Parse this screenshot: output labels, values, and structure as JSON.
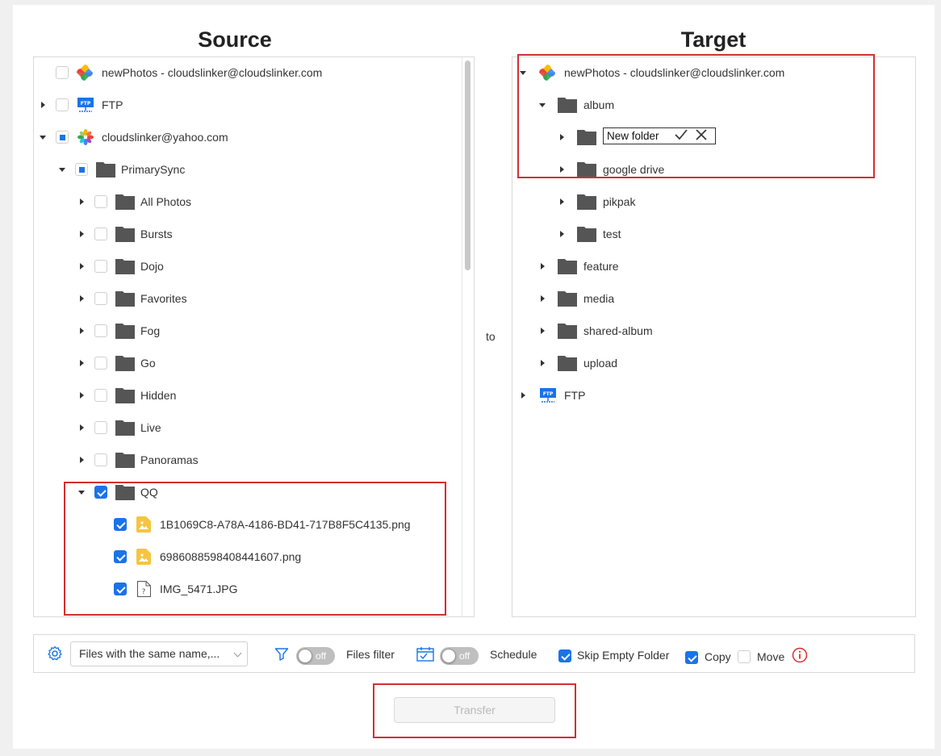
{
  "source": {
    "heading": "Source",
    "items": [
      {
        "label": "newPhotos - cloudslinker@cloudslinker.com"
      },
      {
        "label": "FTP"
      },
      {
        "label": "cloudslinker@yahoo.com"
      },
      {
        "label": "PrimarySync"
      },
      {
        "label": "All Photos"
      },
      {
        "label": "Bursts"
      },
      {
        "label": "Dojo"
      },
      {
        "label": "Favorites"
      },
      {
        "label": "Fog"
      },
      {
        "label": "Go"
      },
      {
        "label": "Hidden"
      },
      {
        "label": "Live"
      },
      {
        "label": "Panoramas"
      },
      {
        "label": "QQ"
      },
      {
        "label": "1B1069C8-A78A-4186-BD41-717B8F5C4135.png"
      },
      {
        "label": "6986088598408441607.png"
      },
      {
        "label": "IMG_5471.JPG"
      }
    ]
  },
  "to_label": "to",
  "target": {
    "heading": "Target",
    "items": [
      {
        "label": "newPhotos - cloudslinker@cloudslinker.com"
      },
      {
        "label": "album"
      },
      {
        "label": "google drive"
      },
      {
        "label": "pikpak"
      },
      {
        "label": "test"
      },
      {
        "label": "feature"
      },
      {
        "label": "media"
      },
      {
        "label": "shared-album"
      },
      {
        "label": "upload"
      },
      {
        "label": "FTP"
      }
    ],
    "new_folder_value": "New folder"
  },
  "toolbar": {
    "conflict_select": "Files with the same name,...",
    "filter_toggle": "off",
    "filter_label": "Files filter",
    "schedule_toggle": "off",
    "schedule_label": "Schedule",
    "skip_empty_label": "Skip Empty Folder",
    "copy_label": "Copy",
    "move_label": "Move"
  },
  "transfer_button": "Transfer",
  "colors": {
    "accent": "#1a73e8",
    "highlight": "#d32f2f",
    "folder": "#555555",
    "image_file": "#f5c542"
  }
}
